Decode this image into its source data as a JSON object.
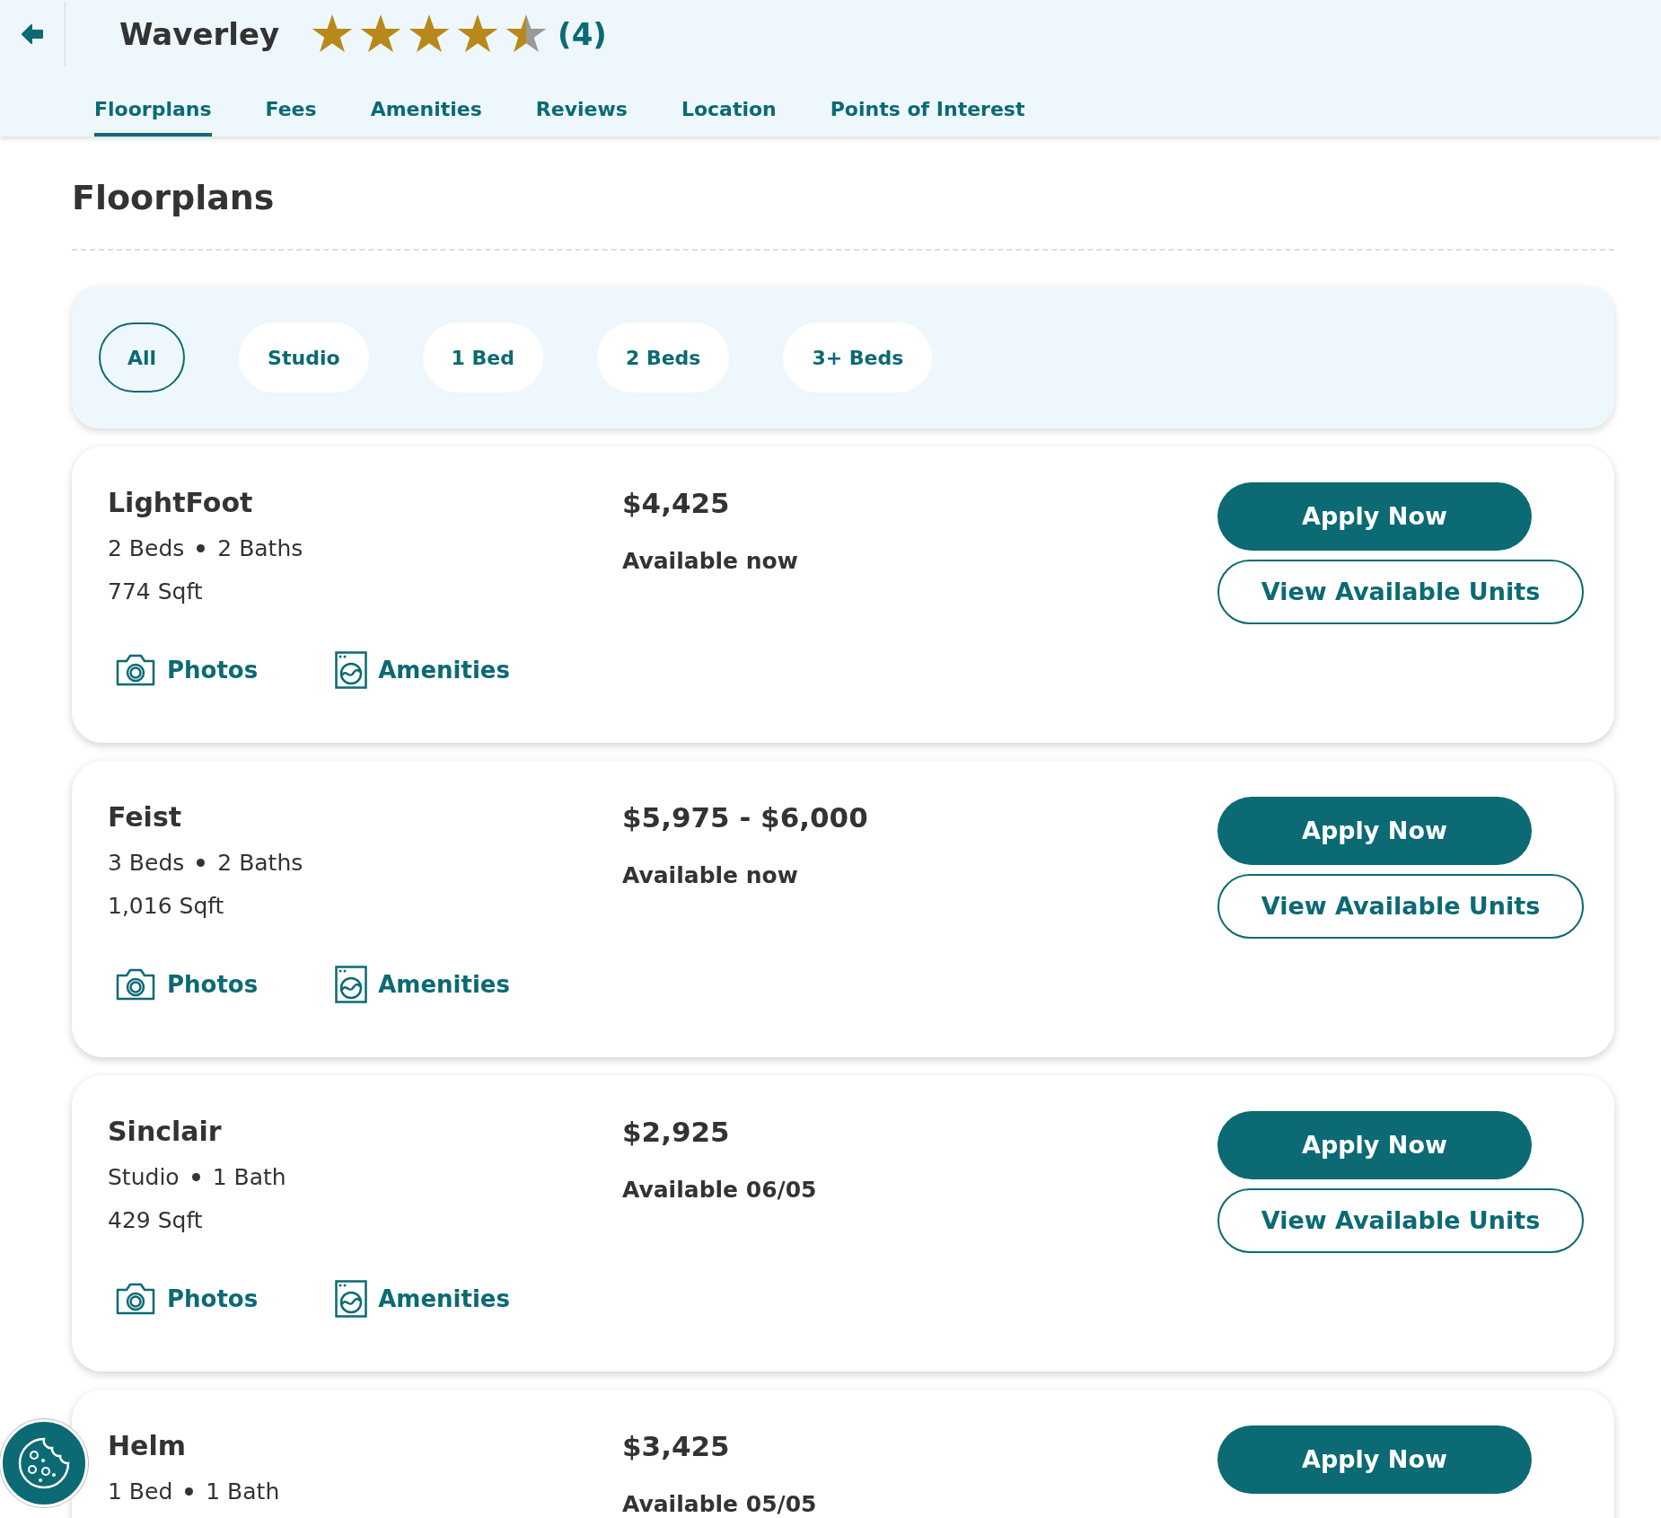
{
  "header": {
    "title": "Waverley",
    "stars": 4.5,
    "review_count": "(4)"
  },
  "tabs": [
    {
      "label": "Floorplans",
      "selected": true
    },
    {
      "label": "Fees",
      "selected": false
    },
    {
      "label": "Amenities",
      "selected": false
    },
    {
      "label": "Reviews",
      "selected": false
    },
    {
      "label": "Location",
      "selected": false
    },
    {
      "label": "Points of Interest",
      "selected": false
    }
  ],
  "heading": "Floorplans",
  "filters": [
    {
      "label": "All",
      "selected": true
    },
    {
      "label": "Studio",
      "selected": false
    },
    {
      "label": "1 Bed",
      "selected": false
    },
    {
      "label": "2 Beds",
      "selected": false
    },
    {
      "label": "3+ Beds",
      "selected": false
    }
  ],
  "floorplans": [
    {
      "name": "LightFoot",
      "beds": "2 Beds",
      "baths": "2 Baths",
      "sqft": "774 Sqft",
      "price": "$4,425",
      "availability": "Available now",
      "apply": "Apply Now",
      "view": "View Available Units",
      "photos": "Photos",
      "amenities": "Amenities"
    },
    {
      "name": "Feist",
      "beds": "3 Beds",
      "baths": "2 Baths",
      "sqft": "1,016 Sqft",
      "price": "$5,975 - $6,000",
      "availability": "Available now",
      "apply": "Apply Now",
      "view": "View Available Units",
      "photos": "Photos",
      "amenities": "Amenities"
    },
    {
      "name": "Sinclair",
      "beds": "Studio",
      "baths": "1 Bath",
      "sqft": "429 Sqft",
      "price": "$2,925",
      "availability": "Available 06/05",
      "apply": "Apply Now",
      "view": "View Available Units",
      "photos": "Photos",
      "amenities": "Amenities"
    },
    {
      "name": "Helm",
      "beds": "1 Bed",
      "baths": "1 Bath",
      "price": "$3,425",
      "availability": "Available 05/05",
      "apply": "Apply Now"
    }
  ]
}
